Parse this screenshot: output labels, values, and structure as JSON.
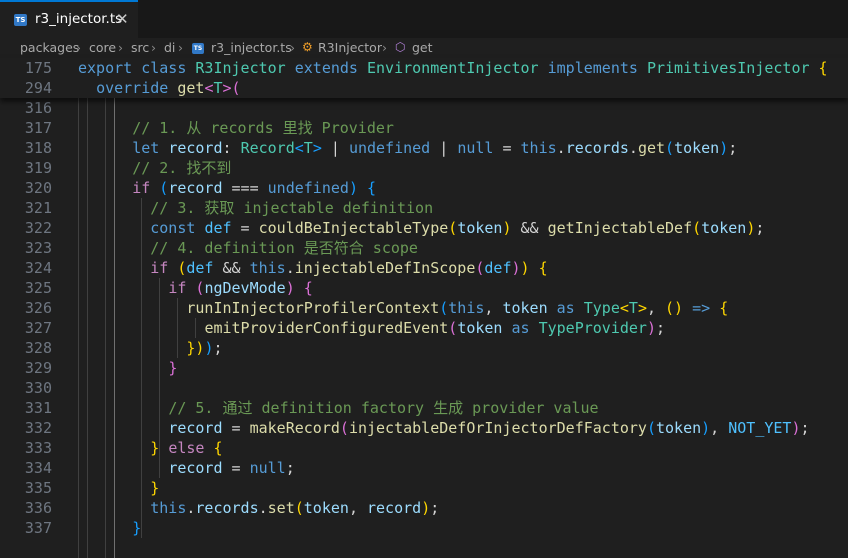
{
  "tab": {
    "icon": "TS",
    "title": "r3_injector.ts",
    "close": "✕"
  },
  "breadcrumb": [
    "packages",
    "core",
    "src",
    "di",
    "r3_injector.ts",
    "R3Injector",
    "get"
  ],
  "breadcrumb_separator": "›",
  "breadcrumb_icons": {
    "file": "typescript-file-icon",
    "class": "class-icon",
    "method": "method-icon"
  },
  "sticky_lines": [
    {
      "n": "175",
      "code": [
        [
          "export",
          "k"
        ],
        [
          " ",
          "tx"
        ],
        [
          "class",
          "k"
        ],
        [
          " ",
          "tx"
        ],
        [
          "R3Injector",
          "t"
        ],
        [
          " ",
          "tx"
        ],
        [
          "extends",
          "k"
        ],
        [
          " ",
          "tx"
        ],
        [
          "EnvironmentInjector",
          "t"
        ],
        [
          " ",
          "tx"
        ],
        [
          "implements",
          "k"
        ],
        [
          " ",
          "tx"
        ],
        [
          "PrimitivesInjector",
          "t"
        ],
        [
          " {",
          "p1"
        ]
      ]
    },
    {
      "n": "294",
      "code": [
        [
          "  ",
          "tx"
        ],
        [
          "override",
          "k"
        ],
        [
          " ",
          "tx"
        ],
        [
          "get",
          "f"
        ],
        [
          "<",
          "p2"
        ],
        [
          "T",
          "t"
        ],
        [
          ">",
          "p2"
        ],
        [
          "(",
          "p2"
        ]
      ]
    }
  ],
  "lines": [
    {
      "n": "316",
      "code": []
    },
    {
      "n": "317",
      "code": [
        [
          "      ",
          "tx"
        ],
        [
          "// 1. 从 records 里找 Provider",
          "cm"
        ]
      ]
    },
    {
      "n": "318",
      "code": [
        [
          "      ",
          "tx"
        ],
        [
          "let",
          "k"
        ],
        [
          " ",
          "tx"
        ],
        [
          "record",
          "v"
        ],
        [
          ": ",
          "tx"
        ],
        [
          "Record",
          "t"
        ],
        [
          "<",
          "p3"
        ],
        [
          "T",
          "t"
        ],
        [
          ">",
          "p3"
        ],
        [
          " | ",
          "tx"
        ],
        [
          "undefined",
          "k"
        ],
        [
          " | ",
          "tx"
        ],
        [
          "null",
          "k"
        ],
        [
          " = ",
          "tx"
        ],
        [
          "this",
          "k"
        ],
        [
          ".",
          "tx"
        ],
        [
          "records",
          "v"
        ],
        [
          ".",
          "tx"
        ],
        [
          "get",
          "f"
        ],
        [
          "(",
          "p3"
        ],
        [
          "token",
          "v"
        ],
        [
          ")",
          "p3"
        ],
        [
          ";",
          "tx"
        ]
      ]
    },
    {
      "n": "319",
      "code": [
        [
          "      ",
          "tx"
        ],
        [
          "// 2. 找不到",
          "cm"
        ]
      ]
    },
    {
      "n": "320",
      "code": [
        [
          "      ",
          "tx"
        ],
        [
          "if",
          "c"
        ],
        [
          " ",
          "tx"
        ],
        [
          "(",
          "p3"
        ],
        [
          "record",
          "v"
        ],
        [
          " === ",
          "tx"
        ],
        [
          "undefined",
          "k"
        ],
        [
          ")",
          "p3"
        ],
        [
          " ",
          "tx"
        ],
        [
          "{",
          "p3"
        ]
      ]
    },
    {
      "n": "321",
      "code": [
        [
          "        ",
          "tx"
        ],
        [
          "// 3. 获取 injectable definition",
          "cm"
        ]
      ]
    },
    {
      "n": "322",
      "code": [
        [
          "        ",
          "tx"
        ],
        [
          "const",
          "k"
        ],
        [
          " ",
          "tx"
        ],
        [
          "def",
          "cst"
        ],
        [
          " = ",
          "tx"
        ],
        [
          "couldBeInjectableType",
          "f"
        ],
        [
          "(",
          "p1"
        ],
        [
          "token",
          "v"
        ],
        [
          ")",
          "p1"
        ],
        [
          " && ",
          "tx"
        ],
        [
          "getInjectableDef",
          "f"
        ],
        [
          "(",
          "p1"
        ],
        [
          "token",
          "v"
        ],
        [
          ")",
          "p1"
        ],
        [
          ";",
          "tx"
        ]
      ]
    },
    {
      "n": "323",
      "code": [
        [
          "        ",
          "tx"
        ],
        [
          "// 4. definition 是否符合 scope",
          "cm"
        ]
      ]
    },
    {
      "n": "324",
      "code": [
        [
          "        ",
          "tx"
        ],
        [
          "if",
          "c"
        ],
        [
          " ",
          "tx"
        ],
        [
          "(",
          "p1"
        ],
        [
          "def",
          "cst"
        ],
        [
          " && ",
          "tx"
        ],
        [
          "this",
          "k"
        ],
        [
          ".",
          "tx"
        ],
        [
          "injectableDefInScope",
          "f"
        ],
        [
          "(",
          "p2"
        ],
        [
          "def",
          "cst"
        ],
        [
          ")",
          "p2"
        ],
        [
          ")",
          "p1"
        ],
        [
          " ",
          "tx"
        ],
        [
          "{",
          "p1"
        ]
      ]
    },
    {
      "n": "325",
      "code": [
        [
          "          ",
          "tx"
        ],
        [
          "if",
          "c"
        ],
        [
          " ",
          "tx"
        ],
        [
          "(",
          "p2"
        ],
        [
          "ngDevMode",
          "v"
        ],
        [
          ")",
          "p2"
        ],
        [
          " ",
          "tx"
        ],
        [
          "{",
          "p2"
        ]
      ]
    },
    {
      "n": "326",
      "code": [
        [
          "            ",
          "tx"
        ],
        [
          "runInInjectorProfilerContext",
          "f"
        ],
        [
          "(",
          "p3"
        ],
        [
          "this",
          "k"
        ],
        [
          ", ",
          "tx"
        ],
        [
          "token",
          "v"
        ],
        [
          " ",
          "tx"
        ],
        [
          "as",
          "k"
        ],
        [
          " ",
          "tx"
        ],
        [
          "Type",
          "t"
        ],
        [
          "<",
          "p1"
        ],
        [
          "T",
          "t"
        ],
        [
          ">",
          "p1"
        ],
        [
          ", ",
          "tx"
        ],
        [
          "()",
          "p1"
        ],
        [
          " ",
          "tx"
        ],
        [
          "=>",
          "k"
        ],
        [
          " ",
          "tx"
        ],
        [
          "{",
          "p1"
        ]
      ]
    },
    {
      "n": "327",
      "code": [
        [
          "              ",
          "tx"
        ],
        [
          "emitProviderConfiguredEvent",
          "f"
        ],
        [
          "(",
          "p2"
        ],
        [
          "token",
          "v"
        ],
        [
          " ",
          "tx"
        ],
        [
          "as",
          "k"
        ],
        [
          " ",
          "tx"
        ],
        [
          "TypeProvider",
          "t"
        ],
        [
          ")",
          "p2"
        ],
        [
          ";",
          "tx"
        ]
      ]
    },
    {
      "n": "328",
      "code": [
        [
          "            ",
          "tx"
        ],
        [
          "})",
          "p1"
        ],
        [
          ")",
          "p3"
        ],
        [
          ";",
          "tx"
        ]
      ]
    },
    {
      "n": "329",
      "code": [
        [
          "          ",
          "tx"
        ],
        [
          "}",
          "p2"
        ]
      ]
    },
    {
      "n": "330",
      "code": []
    },
    {
      "n": "331",
      "code": [
        [
          "          ",
          "tx"
        ],
        [
          "// 5. 通过 definition factory 生成 provider value",
          "cm"
        ]
      ]
    },
    {
      "n": "332",
      "code": [
        [
          "          ",
          "tx"
        ],
        [
          "record",
          "v"
        ],
        [
          " = ",
          "tx"
        ],
        [
          "makeRecord",
          "f"
        ],
        [
          "(",
          "p2"
        ],
        [
          "injectableDefOrInjectorDefFactory",
          "f"
        ],
        [
          "(",
          "p3"
        ],
        [
          "token",
          "v"
        ],
        [
          ")",
          "p3"
        ],
        [
          ", ",
          "tx"
        ],
        [
          "NOT_YET",
          "cst"
        ],
        [
          ")",
          "p2"
        ],
        [
          ";",
          "tx"
        ]
      ]
    },
    {
      "n": "333",
      "code": [
        [
          "        ",
          "tx"
        ],
        [
          "}",
          "p1"
        ],
        [
          " ",
          "tx"
        ],
        [
          "else",
          "c"
        ],
        [
          " ",
          "tx"
        ],
        [
          "{",
          "p1"
        ]
      ]
    },
    {
      "n": "334",
      "code": [
        [
          "          ",
          "tx"
        ],
        [
          "record",
          "v"
        ],
        [
          " = ",
          "tx"
        ],
        [
          "null",
          "k"
        ],
        [
          ";",
          "tx"
        ]
      ]
    },
    {
      "n": "335",
      "code": [
        [
          "        ",
          "tx"
        ],
        [
          "}",
          "p1"
        ]
      ]
    },
    {
      "n": "336",
      "code": [
        [
          "        ",
          "tx"
        ],
        [
          "this",
          "k"
        ],
        [
          ".",
          "tx"
        ],
        [
          "records",
          "v"
        ],
        [
          ".",
          "tx"
        ],
        [
          "set",
          "f"
        ],
        [
          "(",
          "p1"
        ],
        [
          "token",
          "v"
        ],
        [
          ", ",
          "tx"
        ],
        [
          "record",
          "v"
        ],
        [
          ")",
          "p1"
        ],
        [
          ";",
          "tx"
        ]
      ]
    },
    {
      "n": "337",
      "code": [
        [
          "      ",
          "tx"
        ],
        [
          "}",
          "p3"
        ]
      ]
    }
  ]
}
